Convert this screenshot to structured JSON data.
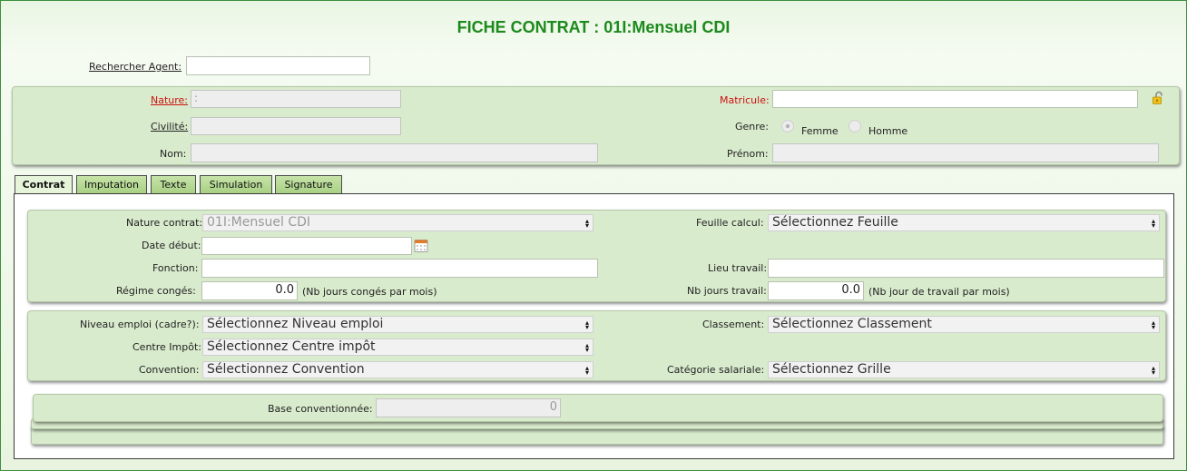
{
  "title": "FICHE CONTRAT : 01I:Mensuel CDI",
  "search": {
    "label": "Rechercher Agent:",
    "value": ""
  },
  "agent": {
    "nature_label": "Nature:",
    "nature_value": ":",
    "civilite_label": "Civilité:",
    "civilite_value": "",
    "nom_label": "Nom:",
    "nom_value": "",
    "matricule_label": "Matricule:",
    "matricule_value": "",
    "genre_label": "Genre:",
    "genre_options": [
      "Femme",
      "Homme"
    ],
    "prenom_label": "Prénom:",
    "prenom_value": ""
  },
  "tabs": [
    "Contrat",
    "Imputation",
    "Texte",
    "Simulation",
    "Signature"
  ],
  "active_tab": "Contrat",
  "contrat": {
    "nature_contrat_label": "Nature contrat:",
    "nature_contrat_value": "01I:Mensuel CDI",
    "date_debut_label": "Date début:",
    "date_debut_value": "",
    "fonction_label": "Fonction:",
    "fonction_value": "",
    "regime_conges_label": "Régime congés:",
    "regime_conges_value": "0.0",
    "regime_conges_hint": "(Nb jours congés par mois)",
    "feuille_calcul_label": "Feuille calcul:",
    "feuille_calcul_value": "Sélectionnez Feuille",
    "lieu_travail_label": "Lieu travail:",
    "lieu_travail_value": "",
    "nb_jours_travail_label": "Nb jours travail:",
    "nb_jours_travail_value": "0.0",
    "nb_jours_travail_hint": "(Nb jour de travail par mois)"
  },
  "classification": {
    "niveau_emploi_label": "Niveau emploi (cadre?):",
    "niveau_emploi_value": "Sélectionnez Niveau emploi",
    "centre_impot_label": "Centre Impôt:",
    "centre_impot_value": "Sélectionnez Centre impôt",
    "convention_label": "Convention:",
    "convention_value": "Sélectionnez Convention",
    "classement_label": "Classement:",
    "classement_value": "Sélectionnez Classement",
    "categorie_salariale_label": "Catégorie salariale:",
    "categorie_salariale_value": "Sélectionnez Grille"
  },
  "base": {
    "label": "Base conventionnée:",
    "value": "0"
  },
  "icons": {
    "lock": "unlock-icon",
    "calendar": "calendar-icon",
    "dropdown": "dropdown-arrow-icon"
  },
  "colors": {
    "title": "#1d8a1d",
    "required_label": "#cc1111",
    "panel": "#d9ebcd",
    "tab": "#a9d184"
  }
}
